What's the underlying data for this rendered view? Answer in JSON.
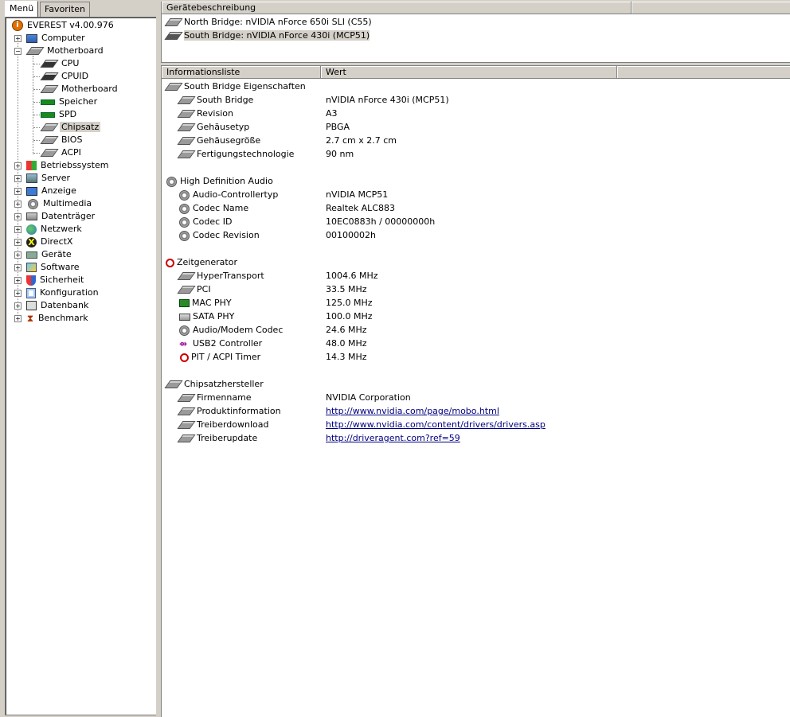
{
  "tabs": {
    "menu": "Menü",
    "favorites": "Favoriten"
  },
  "tree": {
    "root": "EVEREST v4.00.976",
    "items": [
      "Computer",
      "Motherboard",
      "Betriebssystem",
      "Server",
      "Anzeige",
      "Multimedia",
      "Datenträger",
      "Netzwerk",
      "DirectX",
      "Geräte",
      "Software",
      "Sicherheit",
      "Konfiguration",
      "Datenbank",
      "Benchmark"
    ],
    "motherboard_children": [
      "CPU",
      "CPUID",
      "Motherboard",
      "Speicher",
      "SPD",
      "Chipsatz",
      "BIOS",
      "ACPI"
    ]
  },
  "device_panel": {
    "header": "Gerätebeschreibung",
    "rows": [
      "North Bridge: nVIDIA nForce 650i SLI (C55)",
      "South Bridge: nVIDIA nForce 430i (MCP51)"
    ]
  },
  "info_panel": {
    "col_info": "Informationsliste",
    "col_value": "Wert",
    "groups": [
      {
        "title": "South Bridge Eigenschaften",
        "icon": "chip",
        "rows": [
          {
            "label": "South Bridge",
            "value": "nVIDIA nForce 430i (MCP51)"
          },
          {
            "label": "Revision",
            "value": "A3"
          },
          {
            "label": "Gehäusetyp",
            "value": "PBGA"
          },
          {
            "label": "Gehäusegröße",
            "value": "2.7 cm x 2.7 cm"
          },
          {
            "label": "Fertigungstechnologie",
            "value": "90 nm"
          }
        ]
      },
      {
        "title": "High Definition Audio",
        "icon": "speaker",
        "rows": [
          {
            "label": "Audio-Controllertyp",
            "value": "nVIDIA MCP51"
          },
          {
            "label": "Codec Name",
            "value": "Realtek ALC883"
          },
          {
            "label": "Codec ID",
            "value": "10EC0883h / 00000000h"
          },
          {
            "label": "Codec Revision",
            "value": "00100002h"
          }
        ]
      },
      {
        "title": "Zeitgenerator",
        "icon": "clock",
        "rows": [
          {
            "label": "HyperTransport",
            "value": "1004.6 MHz"
          },
          {
            "label": "PCI",
            "value": "33.5 MHz"
          },
          {
            "label": "MAC PHY",
            "value": "125.0 MHz"
          },
          {
            "label": "SATA PHY",
            "value": "100.0 MHz"
          },
          {
            "label": "Audio/Modem Codec",
            "value": "24.6 MHz"
          },
          {
            "label": "USB2 Controller",
            "value": "48.0 MHz"
          },
          {
            "label": "PIT / ACPI Timer",
            "value": "14.3 MHz"
          }
        ]
      },
      {
        "title": "Chipsatzhersteller",
        "icon": "chip",
        "rows": [
          {
            "label": "Firmenname",
            "value": "NVIDIA Corporation"
          },
          {
            "label": "Produktinformation",
            "value": "http://www.nvidia.com/page/mobo.html"
          },
          {
            "label": "Treiberdownload",
            "value": "http://www.nvidia.com/content/drivers/drivers.asp"
          },
          {
            "label": "Treiberupdate",
            "value": "http://driveragent.com?ref=59"
          }
        ]
      }
    ]
  }
}
